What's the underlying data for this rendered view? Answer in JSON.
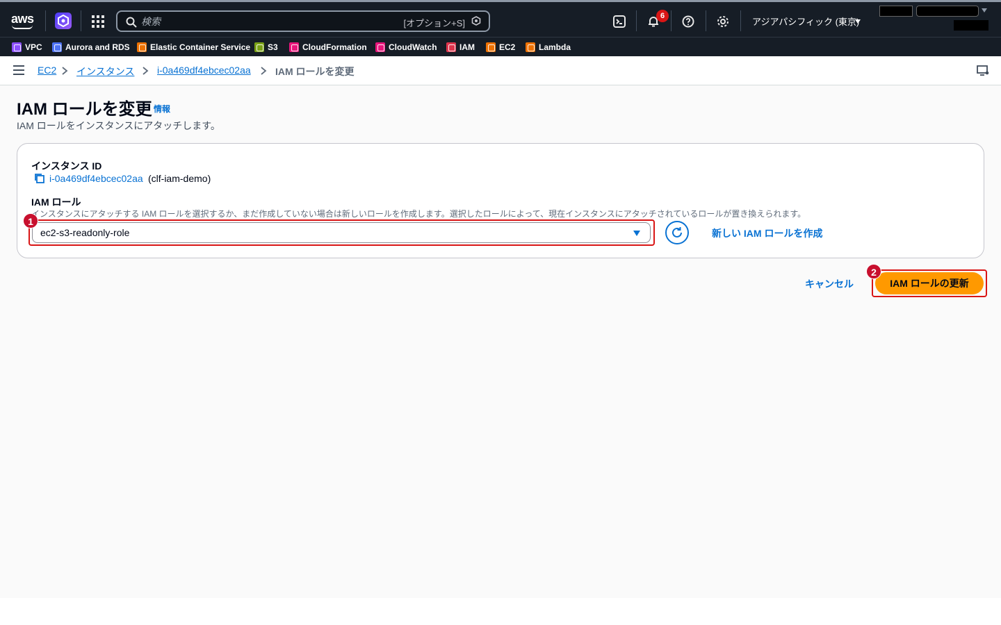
{
  "topbar": {
    "logo_text": "aws",
    "search": {
      "placeholder": "検索",
      "shortcut": "[オプション+S]"
    },
    "notifications_count": "6",
    "region": "アジアパシフィック (東京)",
    "icons": [
      "aws-logo",
      "app-icon",
      "grid-icon",
      "search-icon",
      "cloudshell-icon",
      "bell-icon",
      "help-icon",
      "gear-icon"
    ]
  },
  "favorites": [
    {
      "label": "VPC",
      "color": "#8c4fff"
    },
    {
      "label": "Aurora and RDS",
      "color": "#4d72f3"
    },
    {
      "label": "Elastic Container Service",
      "color": "#ed7100"
    },
    {
      "label": "S3",
      "color": "#7aa116"
    },
    {
      "label": "CloudFormation",
      "color": "#e7157b"
    },
    {
      "label": "CloudWatch",
      "color": "#e7157b"
    },
    {
      "label": "IAM",
      "color": "#dd344c"
    },
    {
      "label": "EC2",
      "color": "#ed7100"
    },
    {
      "label": "Lambda",
      "color": "#ed7100"
    }
  ],
  "breadcrumb": {
    "items": [
      "EC2",
      "インスタンス",
      "i-0a469df4ebcec02aa"
    ],
    "current": "IAM ロールを変更"
  },
  "page": {
    "title": "IAM ロールを変更",
    "info_link": "情報",
    "description": "IAM ロールをインスタンスにアタッチします。"
  },
  "form": {
    "instance_id_label": "インスタンス ID",
    "instance_id": "i-0a469df4ebcec02aa",
    "instance_name": "(clf-iam-demo)",
    "iam_role_label": "IAM ロール",
    "iam_role_hint": "インスタンスにアタッチする IAM ロールを選択するか、まだ作成していない場合は新しいロールを作成します。選択したロールによって、現在インスタンスにアタッチされているロールが置き換えられます。",
    "selected_role": "ec2-s3-readonly-role",
    "create_role_link": "新しい IAM ロールを作成"
  },
  "actions": {
    "cancel": "キャンセル",
    "update": "IAM ロールの更新"
  },
  "annotations": {
    "badge1": "1",
    "badge2": "2",
    "highlight_color": "#d91515"
  },
  "colors": {
    "link": "#0972d3",
    "primary_button": "#ff9900",
    "topbar_bg": "#161d26"
  }
}
